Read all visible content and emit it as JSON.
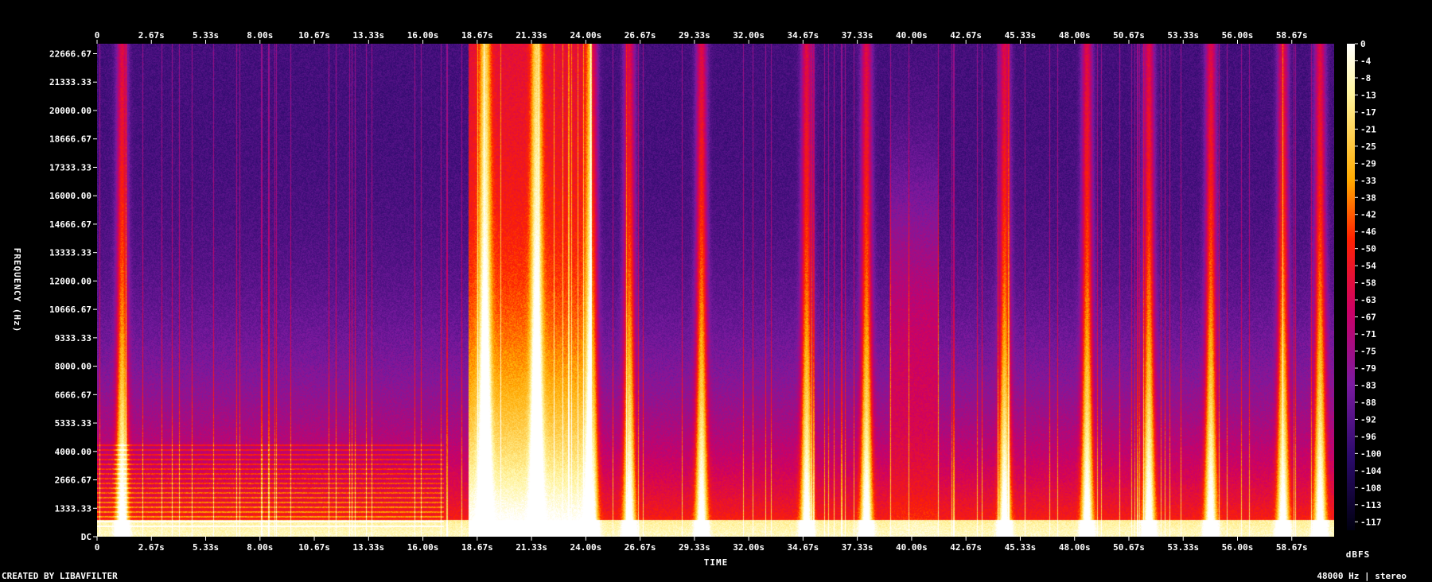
{
  "chart_data": {
    "type": "heatmap",
    "title": "",
    "xlabel": "TIME",
    "ylabel": "FREQUENCY (Hz)",
    "x_ticks": [
      "0",
      "2.67s",
      "5.33s",
      "8.00s",
      "10.67s",
      "13.33s",
      "16.00s",
      "18.67s",
      "21.33s",
      "24.00s",
      "26.67s",
      "29.33s",
      "32.00s",
      "34.67s",
      "37.33s",
      "40.00s",
      "42.67s",
      "45.33s",
      "48.00s",
      "50.67s",
      "53.33s",
      "56.00s",
      "58.67s"
    ],
    "y_ticks": [
      "22666.67",
      "21333.33",
      "20000.00",
      "18666.67",
      "17333.33",
      "16000.00",
      "14666.67",
      "13333.33",
      "12000.00",
      "10666.67",
      "9333.33",
      "8000.00",
      "6666.67",
      "5333.33",
      "4000.00",
      "2666.67",
      "1333.33",
      "DC"
    ],
    "xlim": [
      0,
      60
    ],
    "ylim": [
      0,
      24000
    ],
    "colorbar": {
      "label": "dBFS",
      "ticks": [
        "0",
        "-4",
        "-8",
        "-13",
        "-17",
        "-21",
        "-25",
        "-29",
        "-33",
        "-38",
        "-42",
        "-46",
        "-50",
        "-54",
        "-58",
        "-63",
        "-67",
        "-71",
        "-75",
        "-79",
        "-83",
        "-88",
        "-92",
        "-96",
        "-100",
        "-104",
        "-108",
        "-113",
        "-117"
      ],
      "range": [
        -117,
        0
      ]
    },
    "bursts_s": [
      1.2,
      18.8,
      21.3,
      24.0,
      25.8,
      29.3,
      34.4,
      37.3,
      44.0,
      48.0,
      51.0,
      54.0,
      57.5,
      59.3
    ]
  },
  "footer": {
    "left": "CREATED BY LIBAVFILTER",
    "right": "48000 Hz | stereo"
  }
}
